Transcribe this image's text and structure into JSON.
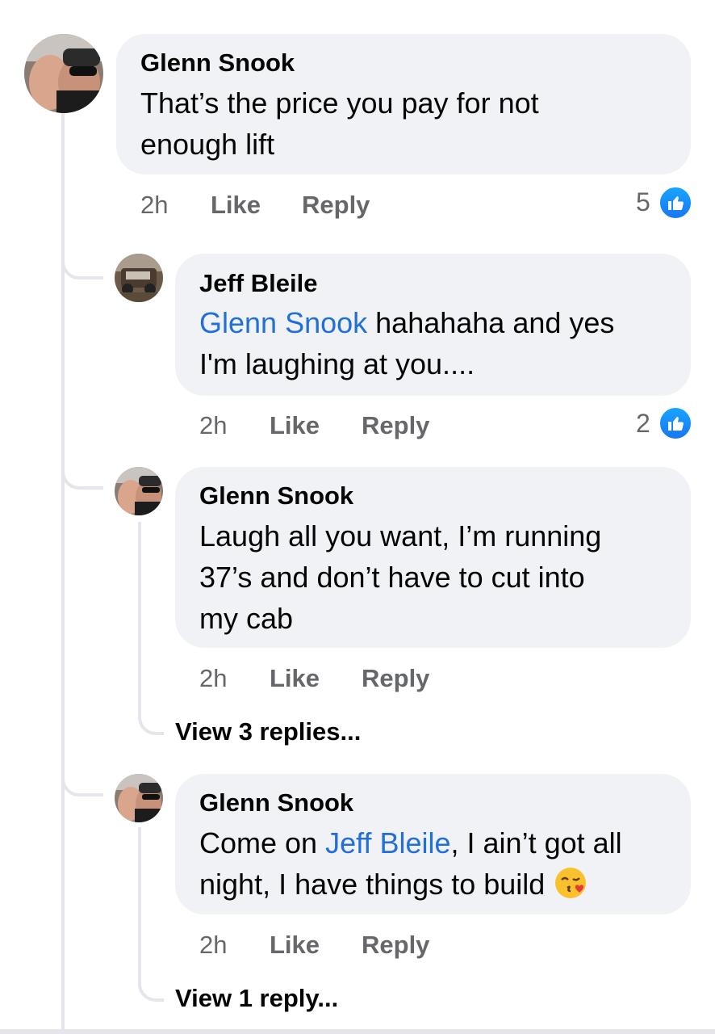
{
  "comments": [
    {
      "author": "Glenn Snook",
      "text_line1": "That’s the price you pay for not",
      "text_line2": "enough lift",
      "time": "2h",
      "like_label": "Like",
      "reply_label": "Reply",
      "reaction_count": "5",
      "reaction_icon": "thumbs-up-icon"
    }
  ],
  "replies": [
    {
      "author": "Jeff Bleile",
      "mention": "Glenn Snook",
      "text_after_mention": " hahahaha and yes",
      "text_line2": "I'm laughing at you....",
      "time": "2h",
      "like_label": "Like",
      "reply_label": "Reply",
      "reaction_count": "2",
      "reaction_icon": "thumbs-up-icon"
    },
    {
      "author": "Glenn Snook",
      "text_line1": "Laugh all you want, I’m running",
      "text_line2": "37’s and don’t have to cut into",
      "text_line3": "my cab",
      "time": "2h",
      "like_label": "Like",
      "reply_label": "Reply",
      "view_replies": "View 3 replies..."
    },
    {
      "author": "Glenn Snook",
      "text_prefix": "Come on ",
      "mention": "Jeff Bleile",
      "text_after_mention": ", I ain’t got all",
      "text_line2": "night, I have things to build ",
      "emoji": "😘",
      "time": "2h",
      "like_label": "Like",
      "reply_label": "Reply",
      "view_replies": "View 1 reply..."
    }
  ],
  "colors": {
    "bubble": "#f0f2f5",
    "mention": "#216fdb",
    "meta": "#65676b",
    "like_blue": "#1877f2",
    "thread_line": "#e4e6eb"
  }
}
